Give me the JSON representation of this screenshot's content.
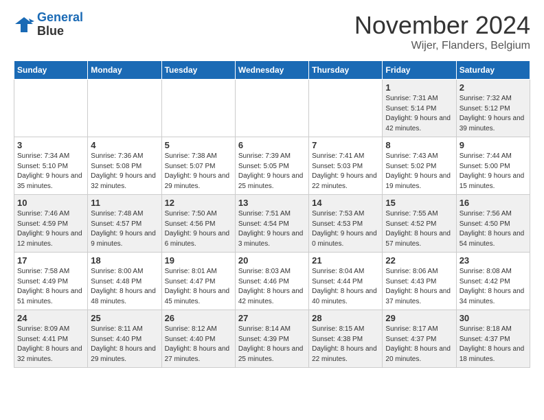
{
  "header": {
    "logo_line1": "General",
    "logo_line2": "Blue",
    "month": "November 2024",
    "location": "Wijer, Flanders, Belgium"
  },
  "days_of_week": [
    "Sunday",
    "Monday",
    "Tuesday",
    "Wednesday",
    "Thursday",
    "Friday",
    "Saturday"
  ],
  "weeks": [
    [
      {
        "day": "",
        "info": ""
      },
      {
        "day": "",
        "info": ""
      },
      {
        "day": "",
        "info": ""
      },
      {
        "day": "",
        "info": ""
      },
      {
        "day": "",
        "info": ""
      },
      {
        "day": "1",
        "info": "Sunrise: 7:31 AM\nSunset: 5:14 PM\nDaylight: 9 hours and 42 minutes."
      },
      {
        "day": "2",
        "info": "Sunrise: 7:32 AM\nSunset: 5:12 PM\nDaylight: 9 hours and 39 minutes."
      }
    ],
    [
      {
        "day": "3",
        "info": "Sunrise: 7:34 AM\nSunset: 5:10 PM\nDaylight: 9 hours and 35 minutes."
      },
      {
        "day": "4",
        "info": "Sunrise: 7:36 AM\nSunset: 5:08 PM\nDaylight: 9 hours and 32 minutes."
      },
      {
        "day": "5",
        "info": "Sunrise: 7:38 AM\nSunset: 5:07 PM\nDaylight: 9 hours and 29 minutes."
      },
      {
        "day": "6",
        "info": "Sunrise: 7:39 AM\nSunset: 5:05 PM\nDaylight: 9 hours and 25 minutes."
      },
      {
        "day": "7",
        "info": "Sunrise: 7:41 AM\nSunset: 5:03 PM\nDaylight: 9 hours and 22 minutes."
      },
      {
        "day": "8",
        "info": "Sunrise: 7:43 AM\nSunset: 5:02 PM\nDaylight: 9 hours and 19 minutes."
      },
      {
        "day": "9",
        "info": "Sunrise: 7:44 AM\nSunset: 5:00 PM\nDaylight: 9 hours and 15 minutes."
      }
    ],
    [
      {
        "day": "10",
        "info": "Sunrise: 7:46 AM\nSunset: 4:59 PM\nDaylight: 9 hours and 12 minutes."
      },
      {
        "day": "11",
        "info": "Sunrise: 7:48 AM\nSunset: 4:57 PM\nDaylight: 9 hours and 9 minutes."
      },
      {
        "day": "12",
        "info": "Sunrise: 7:50 AM\nSunset: 4:56 PM\nDaylight: 9 hours and 6 minutes."
      },
      {
        "day": "13",
        "info": "Sunrise: 7:51 AM\nSunset: 4:54 PM\nDaylight: 9 hours and 3 minutes."
      },
      {
        "day": "14",
        "info": "Sunrise: 7:53 AM\nSunset: 4:53 PM\nDaylight: 9 hours and 0 minutes."
      },
      {
        "day": "15",
        "info": "Sunrise: 7:55 AM\nSunset: 4:52 PM\nDaylight: 8 hours and 57 minutes."
      },
      {
        "day": "16",
        "info": "Sunrise: 7:56 AM\nSunset: 4:50 PM\nDaylight: 8 hours and 54 minutes."
      }
    ],
    [
      {
        "day": "17",
        "info": "Sunrise: 7:58 AM\nSunset: 4:49 PM\nDaylight: 8 hours and 51 minutes."
      },
      {
        "day": "18",
        "info": "Sunrise: 8:00 AM\nSunset: 4:48 PM\nDaylight: 8 hours and 48 minutes."
      },
      {
        "day": "19",
        "info": "Sunrise: 8:01 AM\nSunset: 4:47 PM\nDaylight: 8 hours and 45 minutes."
      },
      {
        "day": "20",
        "info": "Sunrise: 8:03 AM\nSunset: 4:46 PM\nDaylight: 8 hours and 42 minutes."
      },
      {
        "day": "21",
        "info": "Sunrise: 8:04 AM\nSunset: 4:44 PM\nDaylight: 8 hours and 40 minutes."
      },
      {
        "day": "22",
        "info": "Sunrise: 8:06 AM\nSunset: 4:43 PM\nDaylight: 8 hours and 37 minutes."
      },
      {
        "day": "23",
        "info": "Sunrise: 8:08 AM\nSunset: 4:42 PM\nDaylight: 8 hours and 34 minutes."
      }
    ],
    [
      {
        "day": "24",
        "info": "Sunrise: 8:09 AM\nSunset: 4:41 PM\nDaylight: 8 hours and 32 minutes."
      },
      {
        "day": "25",
        "info": "Sunrise: 8:11 AM\nSunset: 4:40 PM\nDaylight: 8 hours and 29 minutes."
      },
      {
        "day": "26",
        "info": "Sunrise: 8:12 AM\nSunset: 4:40 PM\nDaylight: 8 hours and 27 minutes."
      },
      {
        "day": "27",
        "info": "Sunrise: 8:14 AM\nSunset: 4:39 PM\nDaylight: 8 hours and 25 minutes."
      },
      {
        "day": "28",
        "info": "Sunrise: 8:15 AM\nSunset: 4:38 PM\nDaylight: 8 hours and 22 minutes."
      },
      {
        "day": "29",
        "info": "Sunrise: 8:17 AM\nSunset: 4:37 PM\nDaylight: 8 hours and 20 minutes."
      },
      {
        "day": "30",
        "info": "Sunrise: 8:18 AM\nSunset: 4:37 PM\nDaylight: 8 hours and 18 minutes."
      }
    ]
  ]
}
